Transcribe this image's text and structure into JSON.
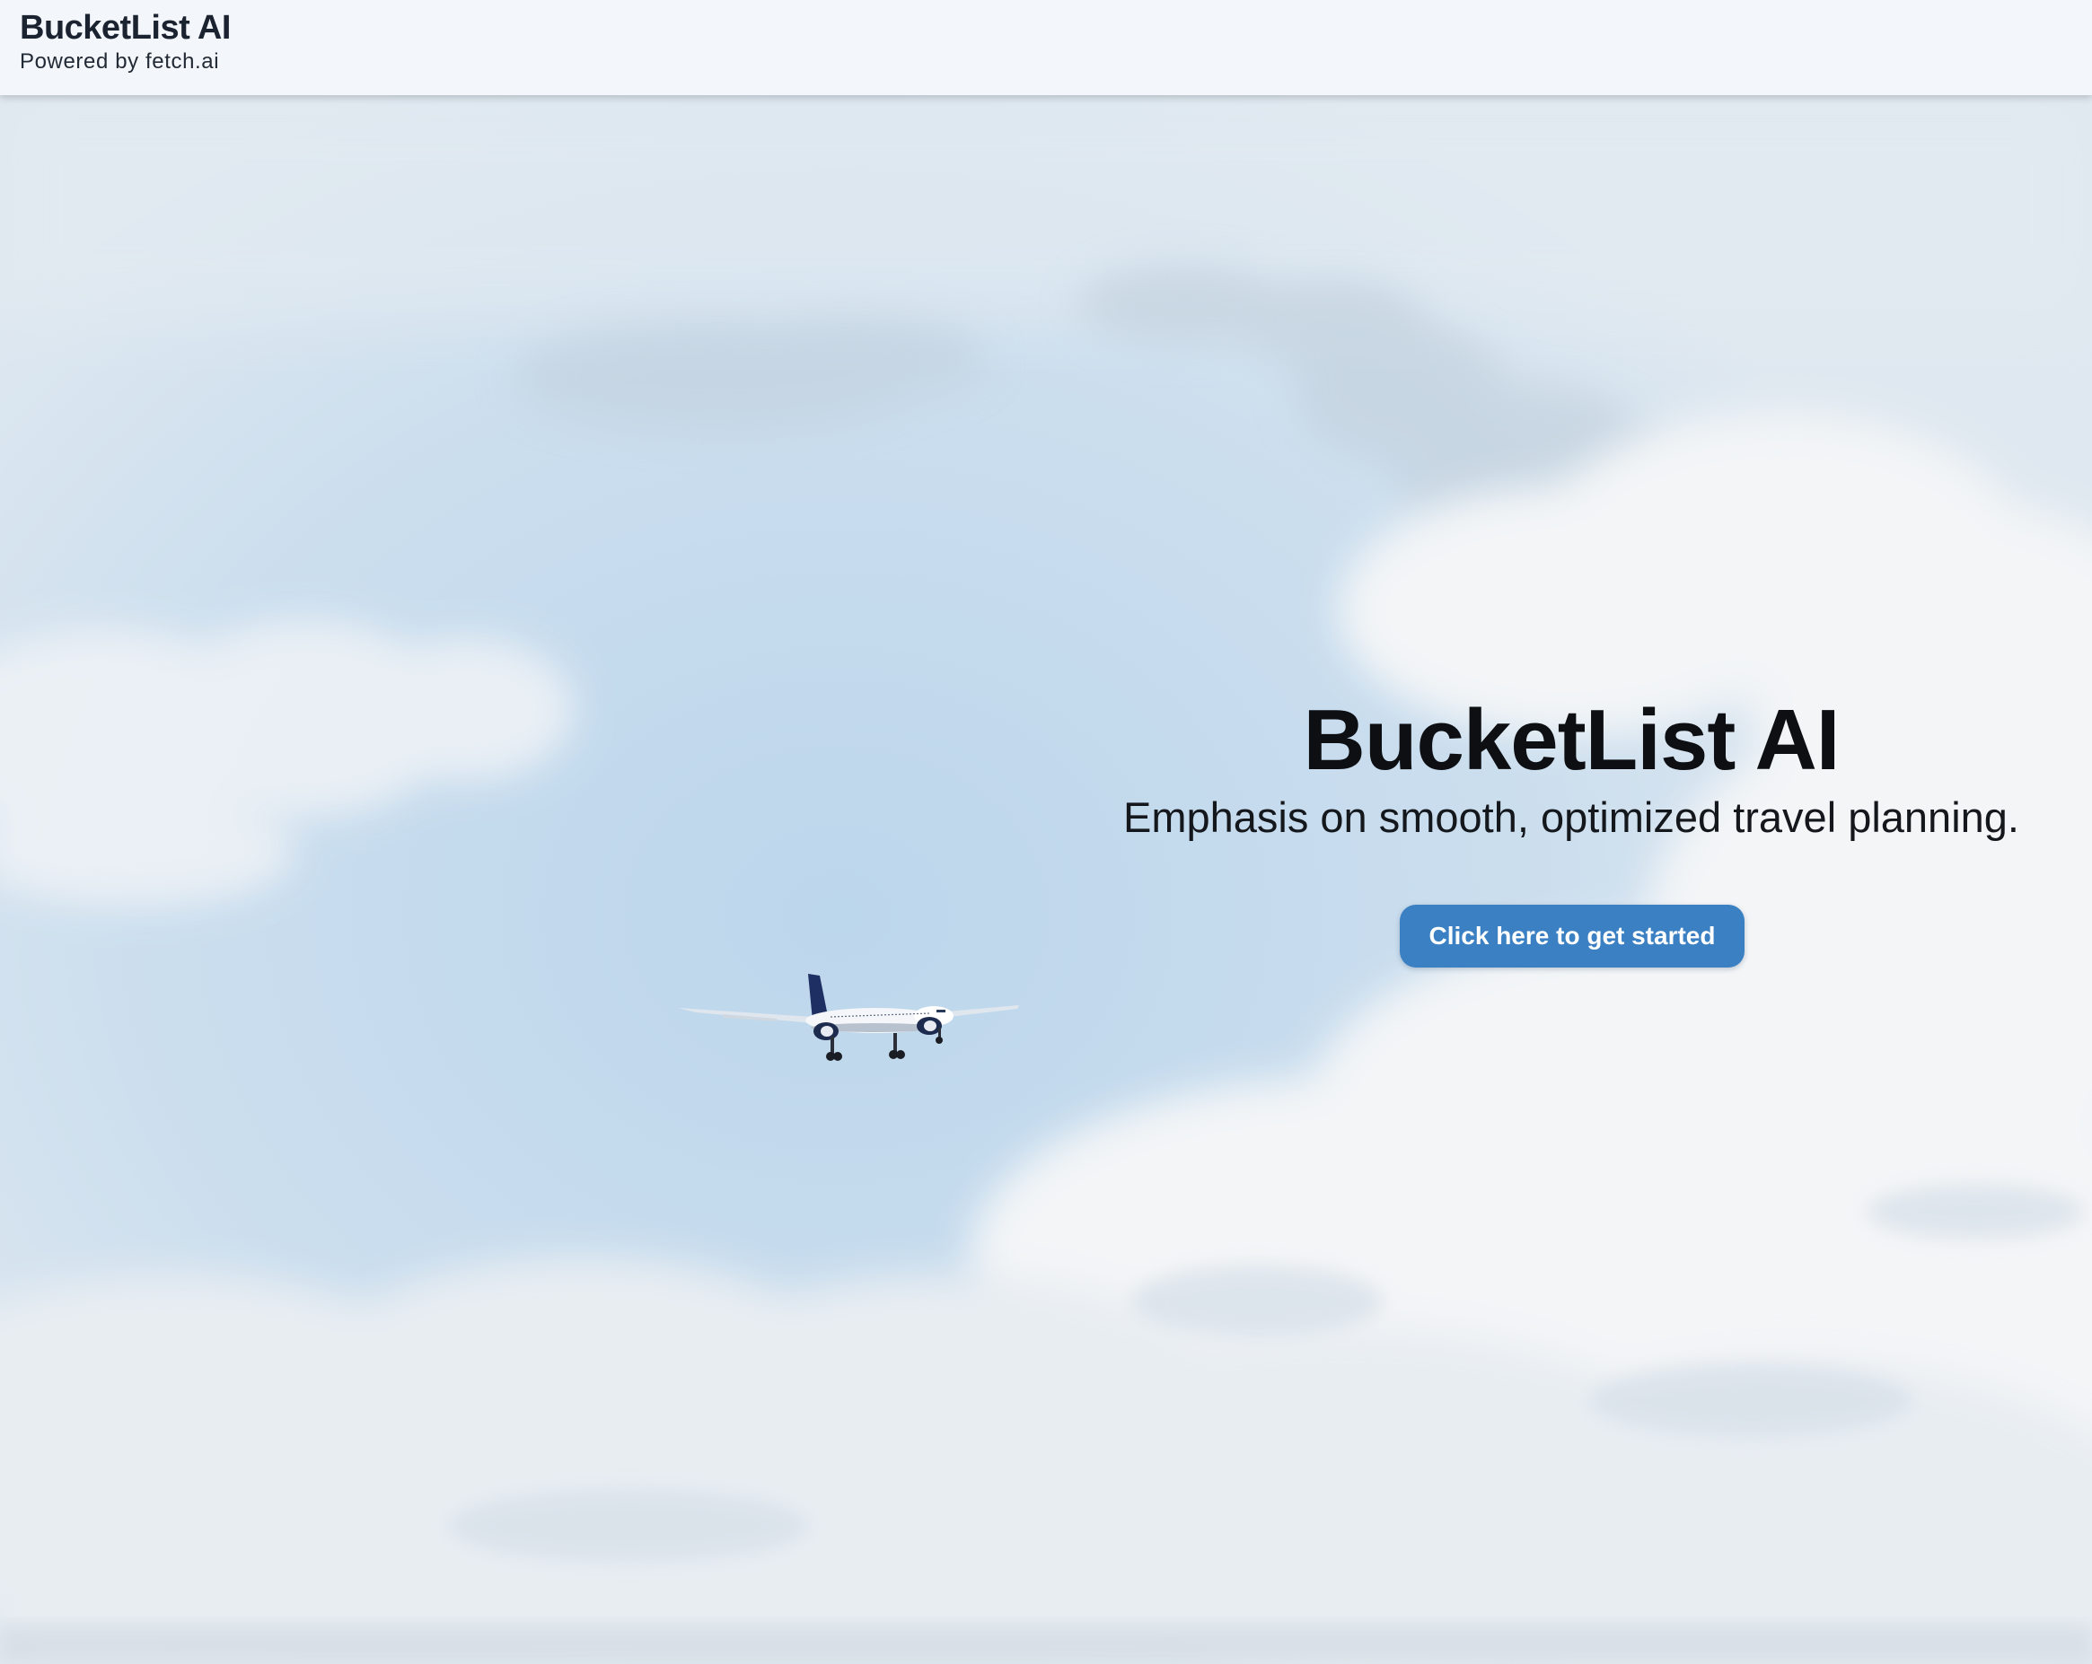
{
  "header": {
    "brand": "BucketList AI",
    "powered_by": "Powered by fetch.ai"
  },
  "hero": {
    "title": "BucketList AI",
    "subtitle": "Emphasis on smooth, optimized travel planning.",
    "cta_label": "Click here to get started"
  },
  "colors": {
    "accent": "#3a80c3",
    "header_bg": "#f4f7fb",
    "sky": "#c9dcec"
  },
  "icons": {
    "background": "sky-with-clouds-image",
    "airplane": "airplane-image"
  }
}
